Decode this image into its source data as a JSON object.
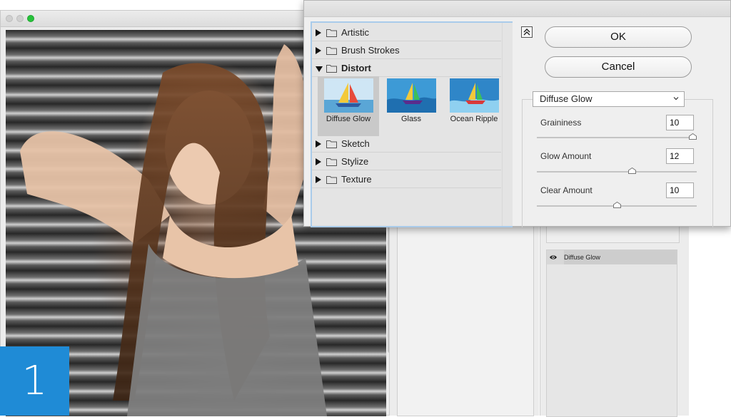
{
  "step_badge": "1",
  "filter_tree": [
    {
      "label": "Artistic",
      "expanded": false
    },
    {
      "label": "Brush Strokes",
      "expanded": false
    },
    {
      "label": "Distort",
      "expanded": true
    },
    {
      "label": "Sketch",
      "expanded": false
    },
    {
      "label": "Stylize",
      "expanded": false
    },
    {
      "label": "Texture",
      "expanded": false
    }
  ],
  "distort_thumbnails": [
    {
      "label": "Diffuse Glow",
      "selected": true
    },
    {
      "label": "Glass",
      "selected": false
    },
    {
      "label": "Ocean Ripple",
      "selected": false
    }
  ],
  "buttons": {
    "ok": "OK",
    "cancel": "Cancel"
  },
  "filter_select": {
    "value": "Diffuse Glow"
  },
  "params": [
    {
      "label": "Graininess",
      "value": "10",
      "slider_fraction": 1.0
    },
    {
      "label": "Glow Amount",
      "value": "12",
      "slider_fraction": 0.6
    },
    {
      "label": "Clear Amount",
      "value": "10",
      "slider_fraction": 0.5
    }
  ],
  "layers": [
    {
      "label": "Diffuse Glow",
      "visible": true
    }
  ],
  "colors": {
    "accent_blue": "#1f8bd6",
    "focus_border": "#a9cbea",
    "traffic_green": "#27c23b"
  },
  "icons": {
    "collapse": "double-chevron-up-icon",
    "folder": "folder-icon",
    "eye": "eye-icon",
    "dropdown": "chevron-down-icon"
  }
}
